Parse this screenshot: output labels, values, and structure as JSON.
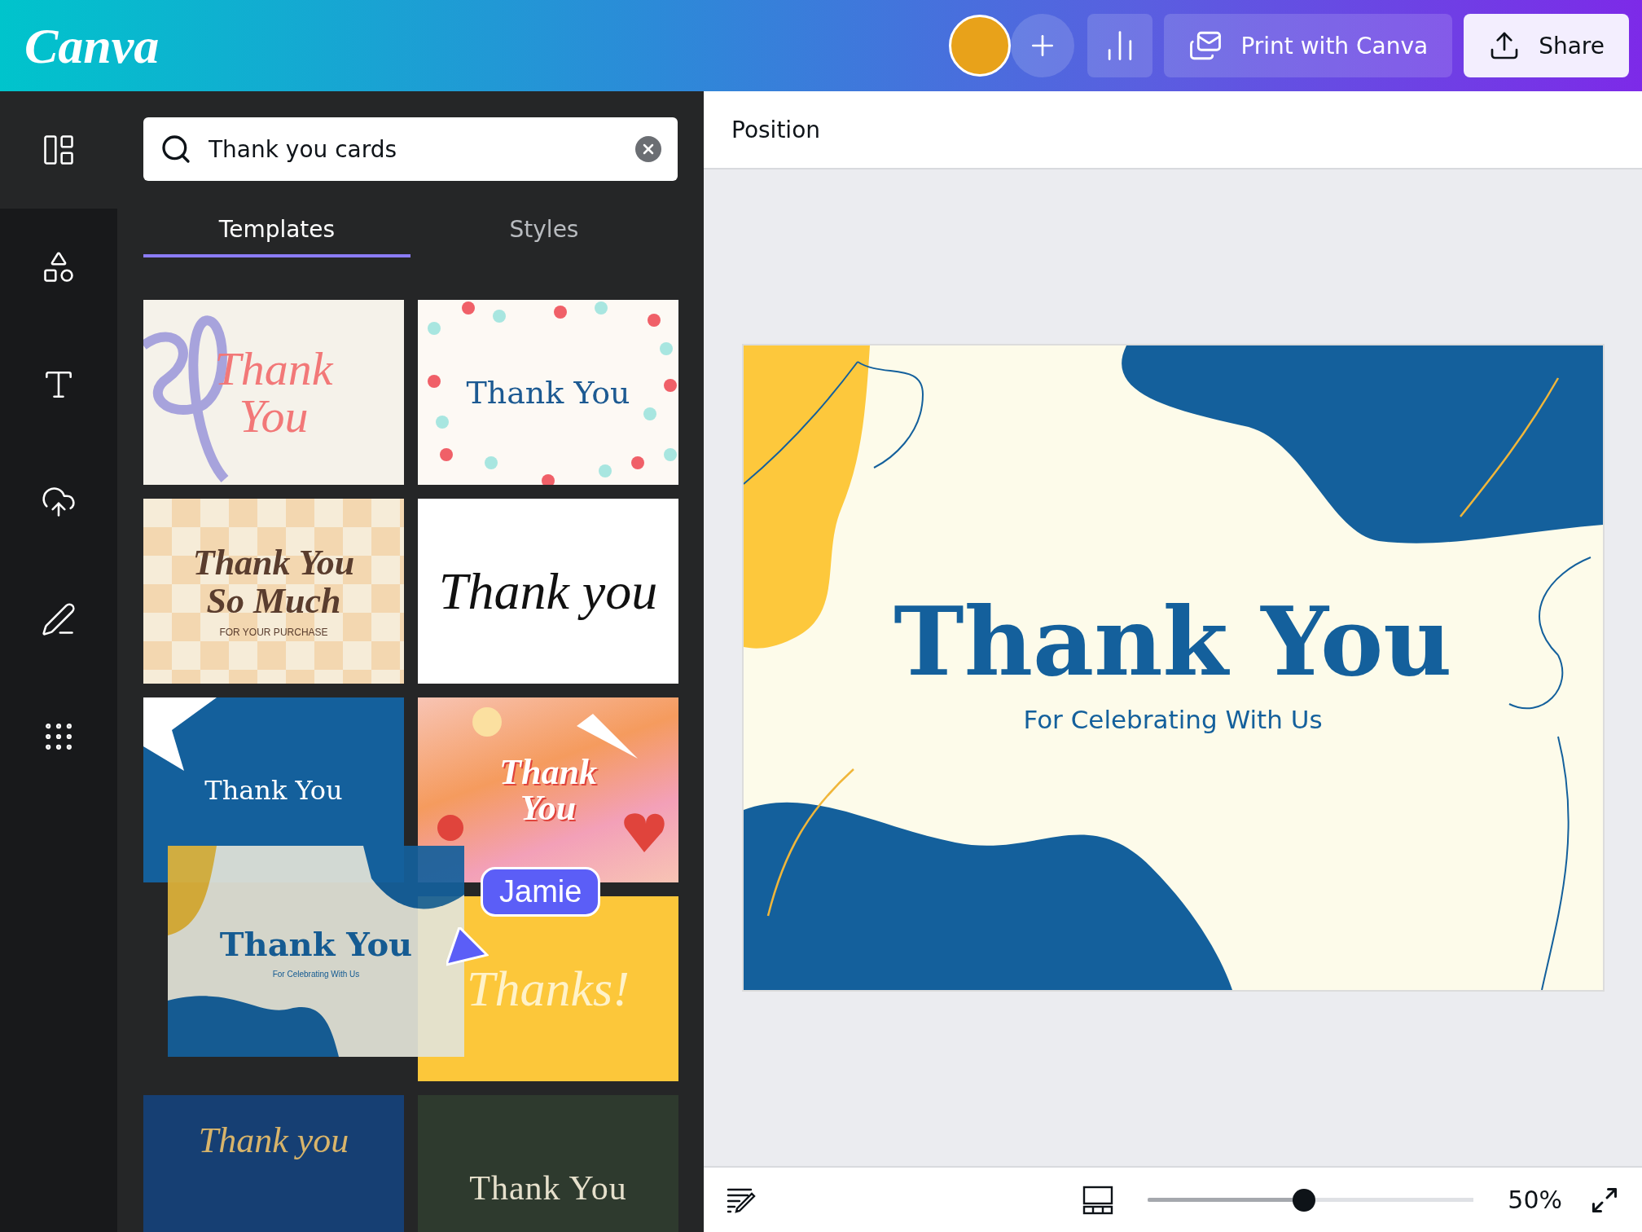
{
  "header": {
    "logo": "Canva",
    "avatar": {
      "kind": "photo"
    },
    "buttons": [
      {
        "kind": "add"
      },
      {
        "kind": "insights"
      },
      {
        "kind": "print",
        "label": "Print with Canva"
      },
      {
        "kind": "share",
        "label": "Share"
      }
    ]
  },
  "rail": [
    {
      "kind": "design",
      "selected": true
    },
    {
      "kind": "elements",
      "selected": false
    },
    {
      "kind": "text",
      "selected": false
    },
    {
      "kind": "uploads",
      "selected": false
    },
    {
      "kind": "draw",
      "selected": false
    },
    {
      "kind": "apps",
      "selected": false
    }
  ],
  "search": {
    "value": "Thank you cards"
  },
  "tabs": [
    {
      "label": "Templates",
      "selected": true
    },
    {
      "label": "Styles",
      "selected": false
    }
  ],
  "templates": [
    {
      "kind": "swirl",
      "lines": [
        "Thank",
        "You"
      ],
      "dragging": false
    },
    {
      "kind": "dots",
      "lines": [
        "Thank You"
      ],
      "dragging": false
    },
    {
      "kind": "checker",
      "lines": [
        "Thank You",
        "So Much"
      ],
      "subtitle": "FOR YOUR PURCHASE",
      "dragging": false
    },
    {
      "kind": "script",
      "lines": [
        "Thank you"
      ],
      "dragging": false
    },
    {
      "kind": "blue",
      "lines": [
        "Thank You"
      ],
      "dragging": false
    },
    {
      "kind": "retro",
      "lines": [
        "Thank",
        "You"
      ],
      "dragging": false
    },
    {
      "kind": "wave",
      "lines": [
        "Thank You"
      ],
      "subtitle": "For Celebrating With Us",
      "dragging": true
    },
    {
      "kind": "yellow",
      "lines": [
        "Thanks!"
      ],
      "dragging": false
    },
    {
      "kind": "navy",
      "lines": [
        "Thank you"
      ],
      "dragging": false
    },
    {
      "kind": "green",
      "lines": [
        "Thank You"
      ],
      "dragging": false
    }
  ],
  "cursor": {
    "name": "Jamie"
  },
  "editor": {
    "toolbar_label": "Position",
    "design": {
      "title": "Thank You",
      "subtitle": "For Celebrating With Us"
    }
  },
  "footer": {
    "zoom": {
      "level": 0.48,
      "reading": "50%"
    }
  }
}
